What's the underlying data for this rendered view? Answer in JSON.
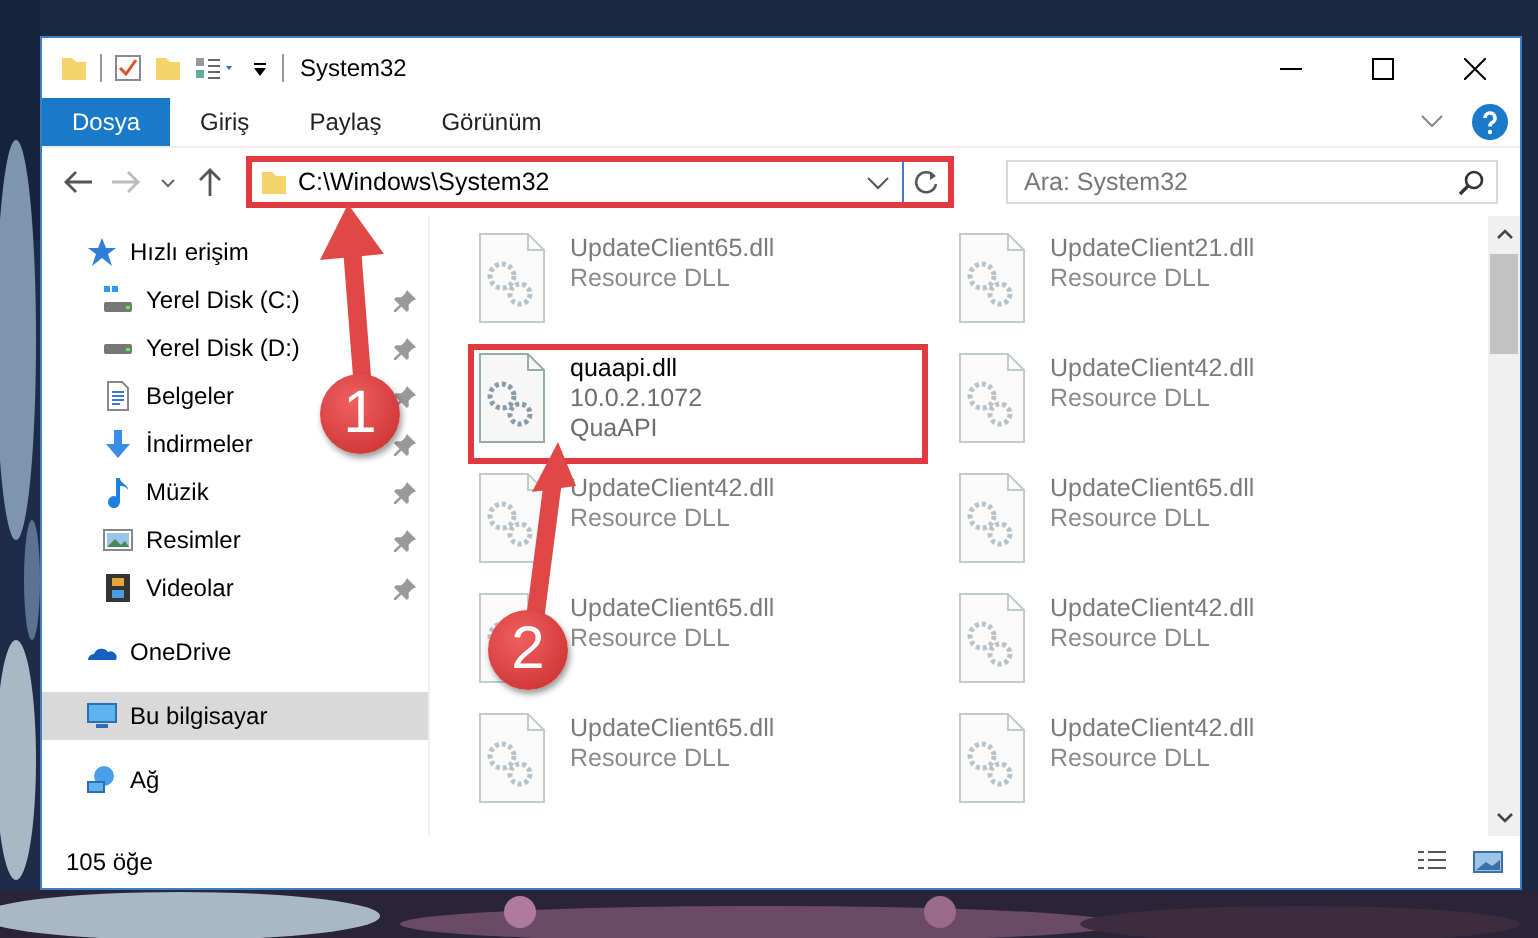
{
  "window": {
    "title": "System32"
  },
  "ribbon_tabs": [
    {
      "label": "Dosya",
      "selected": true
    },
    {
      "label": "Giriş",
      "selected": false
    },
    {
      "label": "Paylaş",
      "selected": false
    },
    {
      "label": "Görünüm",
      "selected": false
    }
  ],
  "address_bar": {
    "path": "C:\\Windows\\System32",
    "highlighted": true
  },
  "search": {
    "placeholder": "Ara: System32"
  },
  "sidebar": {
    "items": [
      {
        "label": "Hızlı erişim",
        "kind": "star",
        "selected": false,
        "children": [
          {
            "label": "Yerel Disk (C:)",
            "kind": "windrive",
            "selected": false,
            "pinned": true
          },
          {
            "label": "Yerel Disk (D:)",
            "kind": "drive",
            "selected": false,
            "pinned": true
          },
          {
            "label": "Belgeler",
            "kind": "document",
            "selected": false,
            "pinned": true
          },
          {
            "label": "İndirmeler",
            "kind": "download",
            "selected": false,
            "pinned": true
          },
          {
            "label": "Müzik",
            "kind": "music",
            "selected": false,
            "pinned": true
          },
          {
            "label": "Resimler",
            "kind": "pictures",
            "selected": false,
            "pinned": true
          },
          {
            "label": "Videolar",
            "kind": "video",
            "selected": false,
            "pinned": true
          }
        ]
      },
      {
        "label": "OneDrive",
        "kind": "cloud",
        "selected": false
      },
      {
        "label": "Bu bilgisayar",
        "kind": "computer",
        "selected": true
      },
      {
        "label": "Ağ",
        "kind": "network",
        "selected": false
      }
    ]
  },
  "files": [
    {
      "name": "UpdateClient65.dll",
      "details": [
        "Resource DLL"
      ],
      "blurred": true,
      "highlighted": false
    },
    {
      "name": "UpdateClient21.dll",
      "details": [
        "Resource DLL"
      ],
      "blurred": true,
      "highlighted": false
    },
    {
      "name": "quaapi.dll",
      "details": [
        "10.0.2.1072",
        "QuaAPI"
      ],
      "blurred": false,
      "highlighted": true
    },
    {
      "name": "UpdateClient42.dll",
      "details": [
        "Resource DLL"
      ],
      "blurred": true,
      "highlighted": false
    },
    {
      "name": "UpdateClient42.dll",
      "details": [
        "Resource DLL"
      ],
      "blurred": true,
      "highlighted": false
    },
    {
      "name": "UpdateClient65.dll",
      "details": [
        "Resource DLL"
      ],
      "blurred": true,
      "highlighted": false
    },
    {
      "name": "UpdateClient65.dll",
      "details": [
        "Resource DLL"
      ],
      "blurred": true,
      "highlighted": false
    },
    {
      "name": "UpdateClient42.dll",
      "details": [
        "Resource DLL"
      ],
      "blurred": true,
      "highlighted": false
    },
    {
      "name": "UpdateClient65.dll",
      "details": [
        "Resource DLL"
      ],
      "blurred": true,
      "highlighted": false
    },
    {
      "name": "UpdateClient42.dll",
      "details": [
        "Resource DLL"
      ],
      "blurred": true,
      "highlighted": false
    }
  ],
  "status_bar": {
    "item_count": "105 öğe"
  },
  "annotations": [
    {
      "label": "1"
    },
    {
      "label": "2"
    }
  ]
}
